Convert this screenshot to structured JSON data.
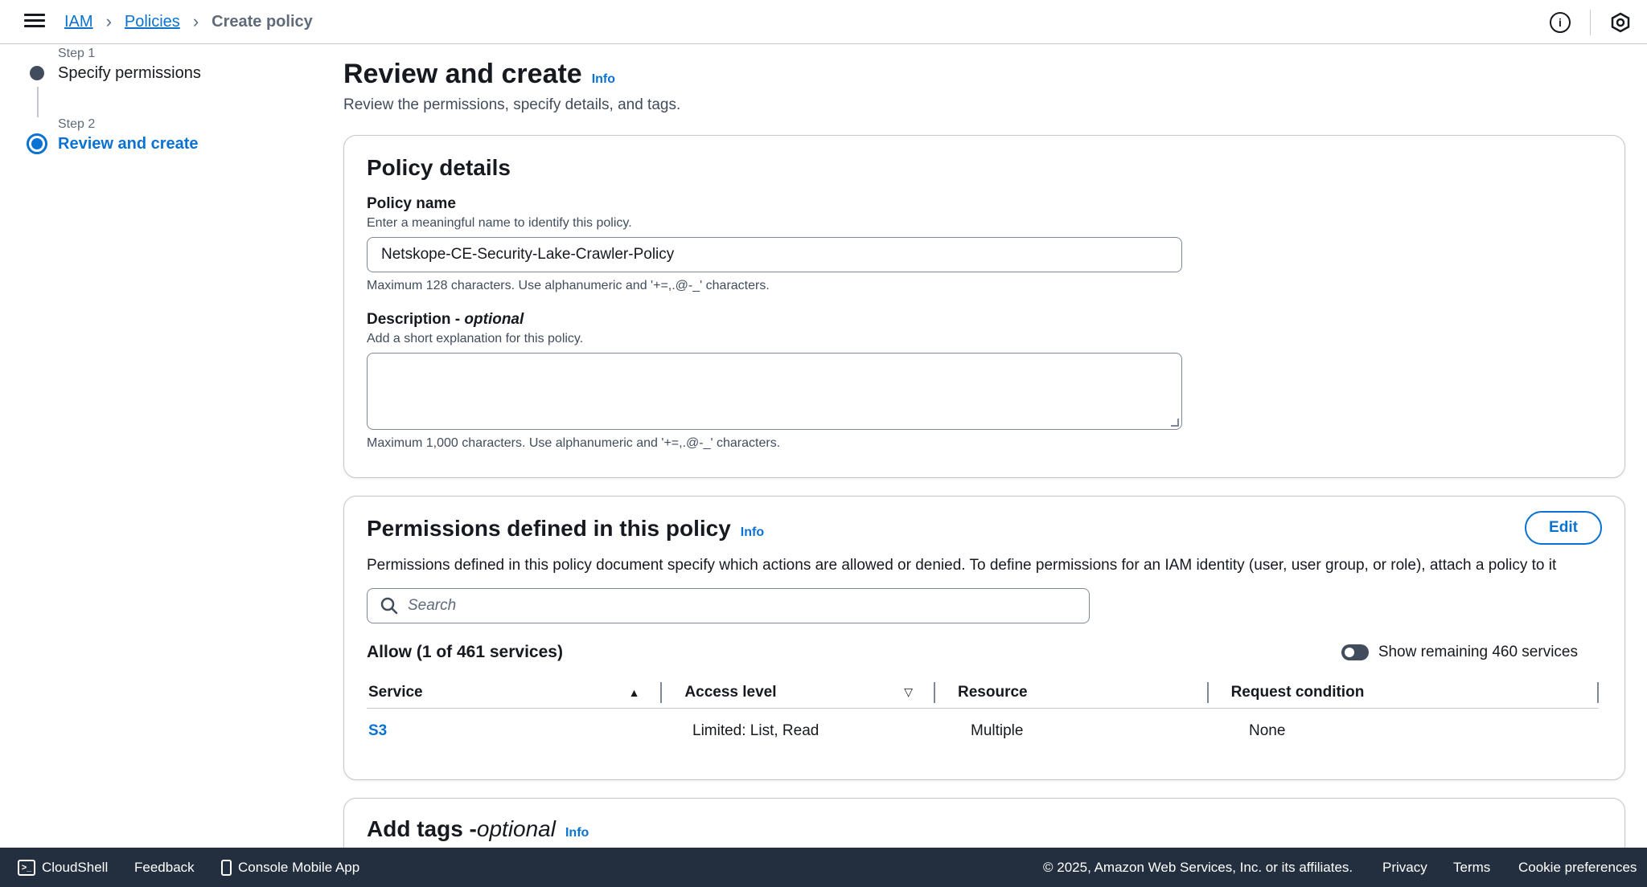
{
  "breadcrumb": {
    "items": [
      "IAM",
      "Policies"
    ],
    "current": "Create policy"
  },
  "steps": [
    {
      "label": "Step 1",
      "name": "Specify permissions"
    },
    {
      "label": "Step 2",
      "name": "Review and create"
    }
  ],
  "page": {
    "title": "Review and create",
    "info": "Info",
    "description": "Review the permissions, specify details, and tags."
  },
  "policy_details": {
    "title": "Policy details",
    "name_label": "Policy name",
    "name_desc": "Enter a meaningful name to identify this policy.",
    "name_value": "Netskope-CE-Security-Lake-Crawler-Policy",
    "name_constraint": "Maximum 128 characters. Use alphanumeric and '+=,.@-_' characters.",
    "desc_label": "Description - ",
    "desc_optional": "optional",
    "desc_desc": "Add a short explanation for this policy.",
    "desc_value": "",
    "desc_constraint": "Maximum 1,000 characters. Use alphanumeric and '+=,.@-_' characters."
  },
  "permissions": {
    "title": "Permissions defined in this policy",
    "info": "Info",
    "edit": "Edit",
    "description": "Permissions defined in this policy document specify which actions are allowed or denied. To define permissions for an IAM identity (user, user group, or role), attach a policy to it",
    "search_placeholder": "Search",
    "allow_title": "Allow (1 of 461 services)",
    "toggle_label": "Show remaining 460 services",
    "columns": [
      "Service",
      "Access level",
      "Resource",
      "Request condition"
    ],
    "rows": [
      {
        "service": "S3",
        "access": "Limited: List, Read",
        "resource": "Multiple",
        "condition": "None"
      }
    ]
  },
  "tags": {
    "title": "Add tags - ",
    "optional": "optional",
    "info": "Info"
  },
  "footer": {
    "cloudshell": "CloudShell",
    "feedback": "Feedback",
    "mobile": "Console Mobile App",
    "copyright": "© 2025, Amazon Web Services, Inc. or its affiliates.",
    "privacy": "Privacy",
    "terms": "Terms",
    "cookies": "Cookie preferences"
  }
}
